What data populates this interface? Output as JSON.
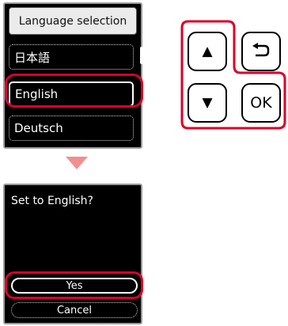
{
  "language_screen": {
    "title": "Language selection",
    "languages": [
      {
        "label": "日本語",
        "selected": false
      },
      {
        "label": "English",
        "selected": true
      },
      {
        "label": "Deutsch",
        "selected": false
      }
    ]
  },
  "confirm_screen": {
    "question": "Set to English?",
    "yes_label": "Yes",
    "cancel_label": "Cancel"
  },
  "keypad": {
    "up": "▲",
    "back": "⮌",
    "down": "▼",
    "ok": "OK"
  },
  "colors": {
    "highlight": "#d9002b",
    "arrow": "#f08f92"
  },
  "icons": [
    "up-arrow-icon",
    "back-icon",
    "down-arrow-icon",
    "scroll-indicator-icon"
  ]
}
